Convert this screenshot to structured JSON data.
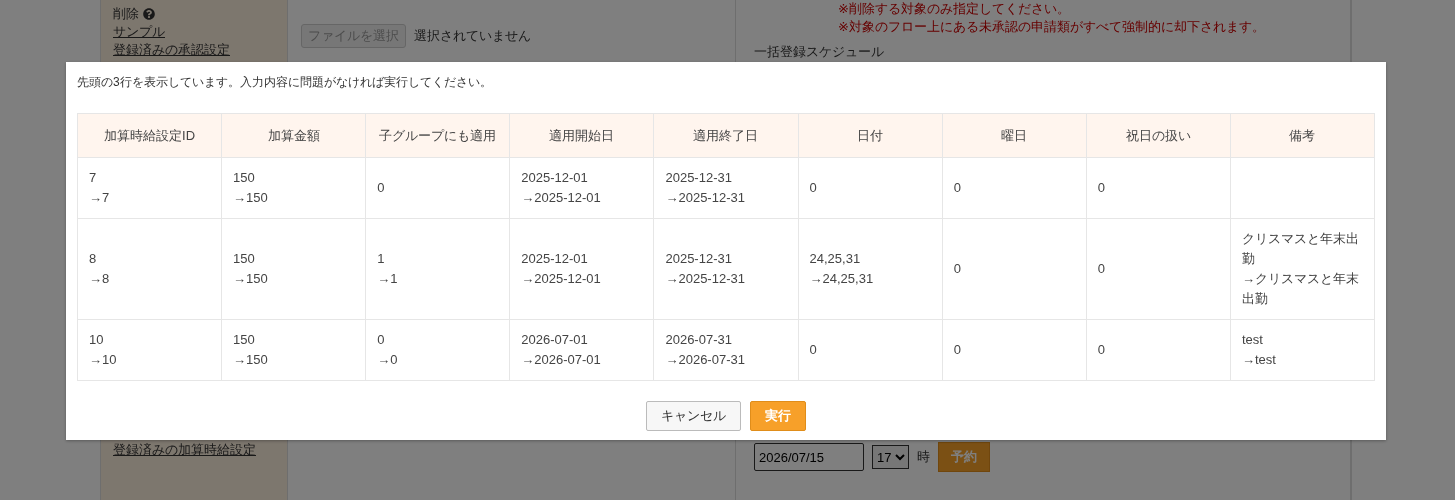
{
  "background": {
    "delete_label": "削除",
    "links": [
      "サンプル",
      "登録済みの承認設定"
    ],
    "file_button": "ファイルを選択",
    "file_status": "選択されていません",
    "notes": [
      "※削除する対象のみ指定してください。",
      "※対象のフロー上にある未承認の申請類がすべて強制的に却下されます。"
    ],
    "schedule_title": "一括登録スケジュール",
    "bottom_link": "登録済みの加算時給設定",
    "date_value": "2026/07/15",
    "hour_value": "17",
    "hour_unit": "時",
    "reserve_button": "予約"
  },
  "dialog": {
    "message": "先頭の3行を表示しています。入力内容に問題がなければ実行してください。",
    "table": {
      "columns": [
        "加算時給設定ID",
        "加算金額",
        "子グループにも適用",
        "適用開始日",
        "適用終了日",
        "日付",
        "曜日",
        "祝日の扱い",
        "備考"
      ],
      "rows": [
        [
          [
            "7",
            "→7"
          ],
          [
            "150",
            "→150"
          ],
          [
            "0"
          ],
          [
            "2025-12-01",
            "→2025-12-01"
          ],
          [
            "2025-12-31",
            "→2025-12-31"
          ],
          [
            "0"
          ],
          [
            "0"
          ],
          [
            "0"
          ],
          []
        ],
        [
          [
            "8",
            "→8"
          ],
          [
            "150",
            "→150"
          ],
          [
            "1",
            "→1"
          ],
          [
            "2025-12-01",
            "→2025-12-01"
          ],
          [
            "2025-12-31",
            "→2025-12-31"
          ],
          [
            "24,25,31",
            "→24,25,31"
          ],
          [
            "0"
          ],
          [
            "0"
          ],
          [
            "クリスマスと年末出勤",
            "→クリスマスと年末出勤"
          ]
        ],
        [
          [
            "10",
            "→10"
          ],
          [
            "150",
            "→150"
          ],
          [
            "0",
            "→0"
          ],
          [
            "2026-07-01",
            "→2026-07-01"
          ],
          [
            "2026-07-31",
            "→2026-07-31"
          ],
          [
            "0"
          ],
          [
            "0"
          ],
          [
            "0"
          ],
          [
            "test",
            "→test"
          ]
        ]
      ]
    },
    "buttons": [
      {
        "label": "キャンセル",
        "kind": "secondary"
      },
      {
        "label": "実行",
        "kind": "primary"
      }
    ]
  }
}
